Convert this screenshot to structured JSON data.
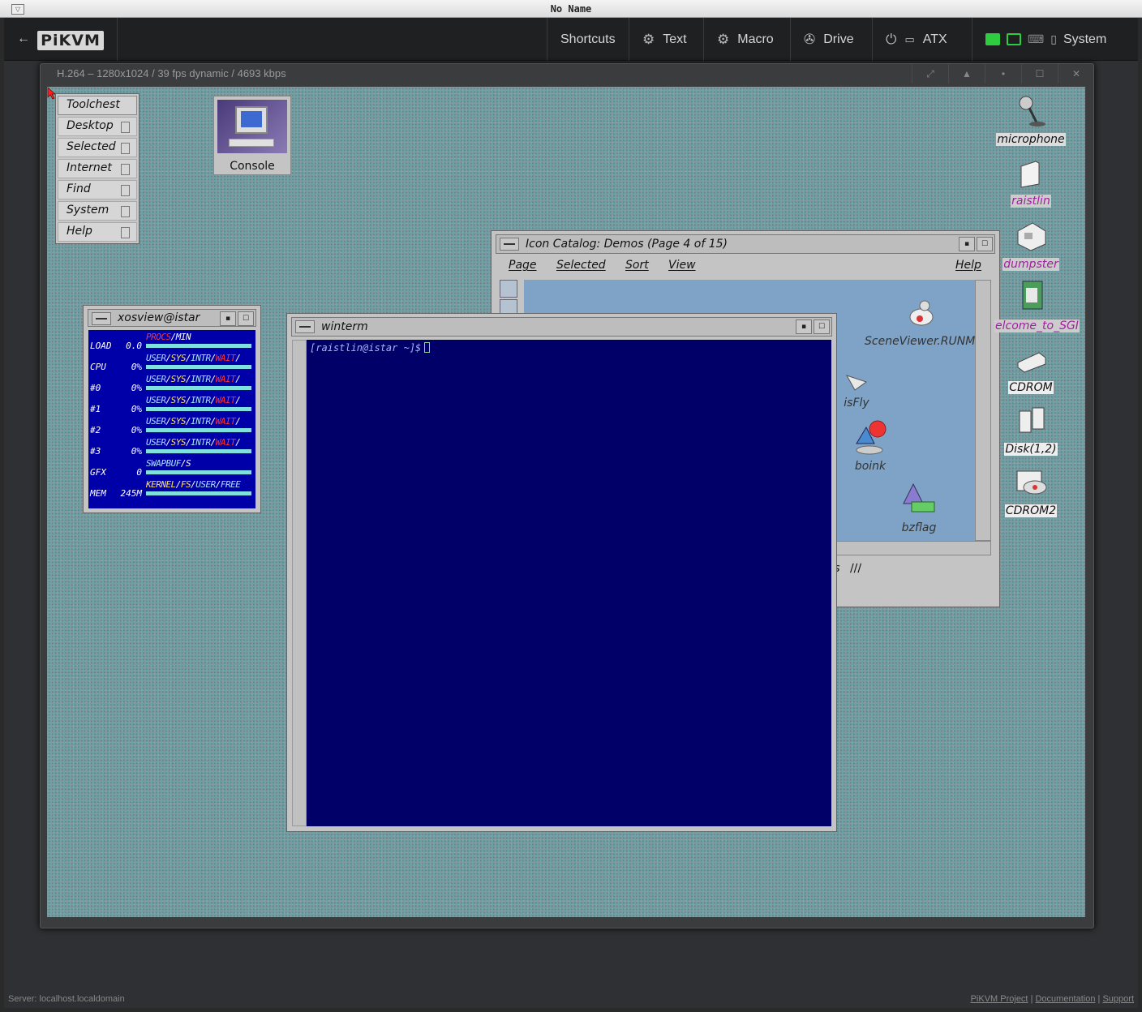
{
  "window": {
    "title": "No Name"
  },
  "navbar": {
    "back": "←",
    "logo": "PiKVM",
    "shortcuts": "Shortcuts",
    "text": "Text",
    "macro": "Macro",
    "drive": "Drive",
    "atx": "ATX",
    "system": "System"
  },
  "stream": {
    "info": "H.264 – 1280x1024 / 39 fps dynamic / 4693 kbps",
    "controls": [
      "⤢",
      "▲",
      "•",
      "☐",
      "✕"
    ]
  },
  "toolchest": {
    "title": "Toolchest",
    "items": [
      "Desktop",
      "Selected",
      "Internet",
      "Find",
      "System",
      "Help"
    ]
  },
  "console": {
    "label": "Console"
  },
  "xosview": {
    "title": "xosview@istar",
    "rows": [
      {
        "label": "LOAD",
        "value": "0.0",
        "legend": [
          "PROCS",
          "/MIN"
        ]
      },
      {
        "label": "CPU",
        "value": "0%",
        "legend": [
          "USER",
          "/",
          "SYS",
          "/",
          "INTR",
          "/",
          "WAIT",
          "/"
        ]
      },
      {
        "label": "#0",
        "value": "0%",
        "legend": [
          "USER",
          "/",
          "SYS",
          "/",
          "INTR",
          "/",
          "WAIT",
          "/"
        ]
      },
      {
        "label": "#1",
        "value": "0%",
        "legend": [
          "USER",
          "/",
          "SYS",
          "/",
          "INTR",
          "/",
          "WAIT",
          "/"
        ]
      },
      {
        "label": "#2",
        "value": "0%",
        "legend": [
          "USER",
          "/",
          "SYS",
          "/",
          "INTR",
          "/",
          "WAIT",
          "/"
        ]
      },
      {
        "label": "#3",
        "value": "0%",
        "legend": [
          "USER",
          "/",
          "SYS",
          "/",
          "INTR",
          "/",
          "WAIT",
          "/"
        ]
      },
      {
        "label": "GFX",
        "value": "0",
        "legend": [
          "SWAPBUF",
          "/S"
        ]
      },
      {
        "label": "MEM",
        "value": "245M",
        "legend": [
          "KERNEL",
          "/",
          "FS",
          "/",
          "USER",
          "/",
          "FREE"
        ]
      }
    ]
  },
  "catalog": {
    "title": "Icon Catalog: Demos (Page 4 of 15)",
    "menu": [
      "Page",
      "Selected",
      "Sort",
      "View"
    ],
    "help": "Help",
    "icons": [
      {
        "label": "SceneViewer.RUNME"
      },
      {
        "label": "isFly"
      },
      {
        "label": "boink"
      },
      {
        "label": "bzflag"
      }
    ],
    "tab": "mos"
  },
  "winterm": {
    "title": "winterm",
    "prompt": "[raistlin@istar ~]$"
  },
  "desktop_icons": [
    {
      "label": "microphone"
    },
    {
      "label": "raistlin"
    },
    {
      "label": "dumpster"
    },
    {
      "label": "elcome_to_SGI"
    },
    {
      "label": "CDROM"
    },
    {
      "label": "Disk(1,2)"
    },
    {
      "label": "CDROM2"
    }
  ],
  "footer": {
    "server": "Server: localhost.localdomain",
    "links": [
      "PiKVM Project",
      "Documentation",
      "Support"
    ]
  },
  "colors": {
    "legend_user": "#a8e0ff",
    "legend_sys": "#ffe060",
    "legend_intr": "#a8e0ff",
    "legend_wait": "#ff3030",
    "legend_procs": "#ff3030",
    "status_green": "#2ecc40"
  }
}
